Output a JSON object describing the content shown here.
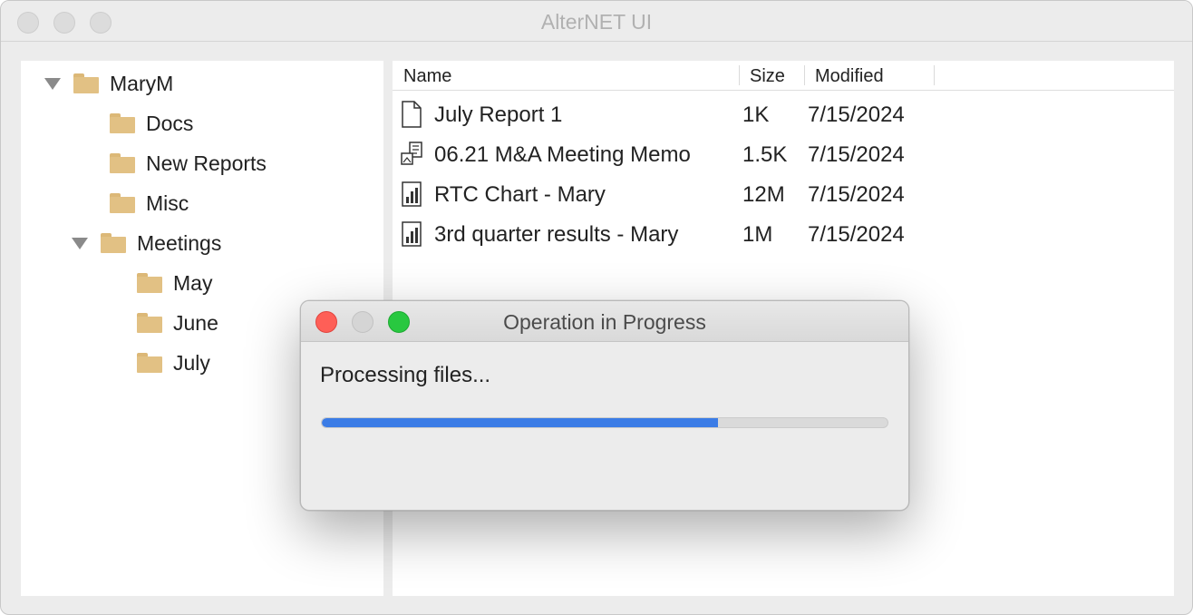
{
  "window": {
    "title": "AlterNET UI"
  },
  "tree": {
    "root": "MaryM",
    "items": [
      "Docs",
      "New Reports",
      "Misc"
    ],
    "meetings": {
      "label": "Meetings",
      "children": [
        "May",
        "June",
        "July"
      ]
    }
  },
  "list": {
    "columns": {
      "name": "Name",
      "size": "Size",
      "modified": "Modified"
    },
    "rows": [
      {
        "name": "July Report 1",
        "size": "1K",
        "modified": "7/15/2024",
        "icon": "document-icon"
      },
      {
        "name": "06.21 M&A Meeting Memo",
        "size": "1.5K",
        "modified": "7/15/2024",
        "icon": "image-document-icon"
      },
      {
        "name": "RTC Chart - Mary",
        "size": "12M",
        "modified": "7/15/2024",
        "icon": "chart-icon"
      },
      {
        "name": "3rd quarter results - Mary",
        "size": "1M",
        "modified": "7/15/2024",
        "icon": "chart-icon"
      }
    ]
  },
  "dialog": {
    "title": "Operation in Progress",
    "message": "Processing files...",
    "progress": 0.7,
    "progress_color": "#3b7ce6"
  },
  "colors": {
    "folder": "#e2c184",
    "close": "#fe5f57",
    "zoom": "#28c840"
  }
}
